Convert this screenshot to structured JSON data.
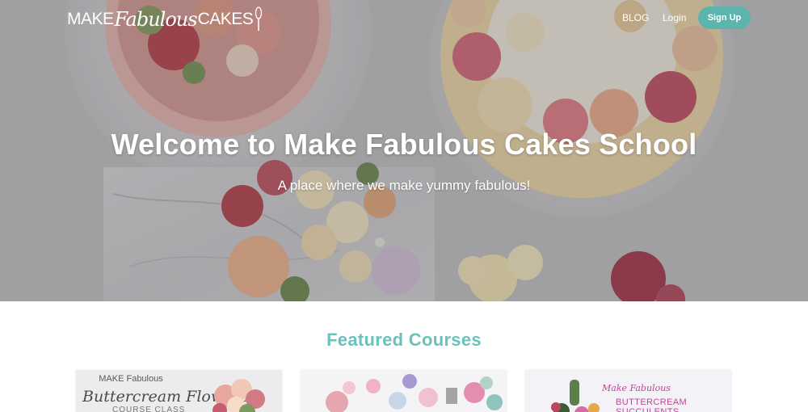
{
  "brand": {
    "logo_part1": "MAKE",
    "logo_part2": "Fabulous",
    "logo_part3": "CAKES"
  },
  "nav": {
    "blog": "BLOG",
    "login": "Login",
    "signup": "Sign Up"
  },
  "hero": {
    "title": "Welcome to Make Fabulous Cakes School",
    "subtitle": "A place where we make yummy fabulous!"
  },
  "featured": {
    "title": "Featured Courses",
    "courses": [
      {
        "brand_line": "MAKE Fabulous",
        "title": "Buttercream Flowers",
        "subtitle": "COURSE CLASS"
      },
      {
        "brand_line": "",
        "title": "",
        "subtitle": ""
      },
      {
        "brand_line": "Make Fabulous",
        "title": "BUTTERCREAM SUCCULENTS",
        "subtitle": ""
      }
    ]
  },
  "colors": {
    "accent": "#5bb5ad",
    "featured_title": "#69c2bb",
    "card3_text": "#c2439b"
  }
}
